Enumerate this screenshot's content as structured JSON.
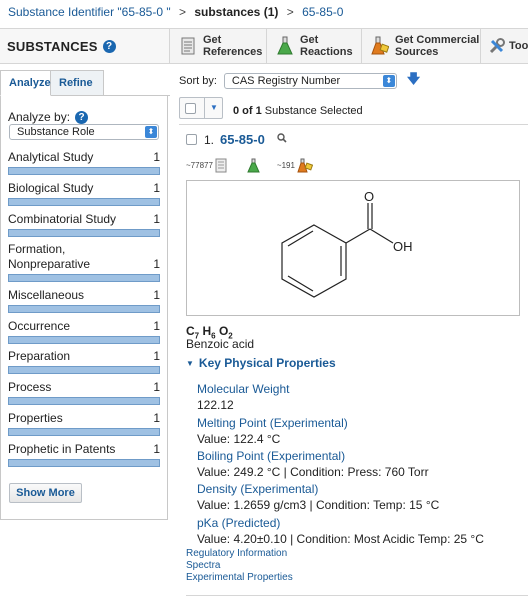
{
  "breadcrumb": {
    "item1": "Substance Identifier \"65-85-0 \"",
    "item2": "substances (1)",
    "item3": "65-85-0",
    "sep": ">"
  },
  "header": {
    "title": "SUBSTANCES",
    "tools": [
      {
        "line1": "Get",
        "line2": "References",
        "icon": "document-icon"
      },
      {
        "line1": "Get",
        "line2": "Reactions",
        "icon": "flask-icon"
      },
      {
        "line1": "Get Commercial",
        "line2": "Sources",
        "icon": "commercial-flask-icon"
      },
      {
        "line1": "Too",
        "line2": "",
        "icon": "tools-icon"
      }
    ]
  },
  "left_tabs": {
    "analyze": "Analyze",
    "refine": "Refine"
  },
  "analyze": {
    "label": "Analyze by:",
    "select_value": "Substance Role",
    "facets": [
      {
        "label": "Analytical Study",
        "count": "1"
      },
      {
        "label": "Biological Study",
        "count": "1"
      },
      {
        "label": "Combinatorial Study",
        "count": "1"
      },
      {
        "label": "Formation,",
        "label2": "Nonpreparative",
        "count": "1"
      },
      {
        "label": "Miscellaneous",
        "count": "1"
      },
      {
        "label": "Occurrence",
        "count": "1"
      },
      {
        "label": "Preparation",
        "count": "1"
      },
      {
        "label": "Process",
        "count": "1"
      },
      {
        "label": "Properties",
        "count": "1"
      },
      {
        "label": "Prophetic in Patents",
        "count": "1"
      }
    ],
    "show_more": "Show More"
  },
  "sort": {
    "label": "Sort by:",
    "value": "CAS Registry Number"
  },
  "selection": {
    "count_bold": "0 of 1",
    "text": "Substance Selected"
  },
  "result": {
    "number": "1.",
    "id": "65-85-0",
    "references_count": "~77877",
    "commercial_count": "~191",
    "structure_labels": {
      "o": "O",
      "oh": "OH"
    },
    "formula": {
      "c": "C",
      "c_n": "7",
      "h": "H",
      "h_n": "6",
      "o": "O",
      "o_n": "2"
    },
    "name": "Benzoic acid"
  },
  "key_props": {
    "title": "Key Physical Properties",
    "items": [
      {
        "name": "Molecular Weight",
        "value": "122.12"
      },
      {
        "name": "Melting Point (Experimental)",
        "value": "Value: 122.4 °C"
      },
      {
        "name": "Boiling Point (Experimental)",
        "value": "Value: 249.2 °C | Condition: Press: 760 Torr"
      },
      {
        "name": "Density (Experimental)",
        "value": "Value: 1.2659 g/cm3 | Condition: Temp: 15 °C"
      },
      {
        "name": "pKa (Predicted)",
        "value": "Value: 4.20±0.10 | Condition: Most Acidic Temp: 25 °C"
      }
    ]
  },
  "links": {
    "reg": "Regulatory Information",
    "spectra": "Spectra",
    "exp": "Experimental Properties"
  },
  "colors": {
    "link": "#1a5a96",
    "bar": "#9fc1e3",
    "accent": "#2c6fc2"
  }
}
